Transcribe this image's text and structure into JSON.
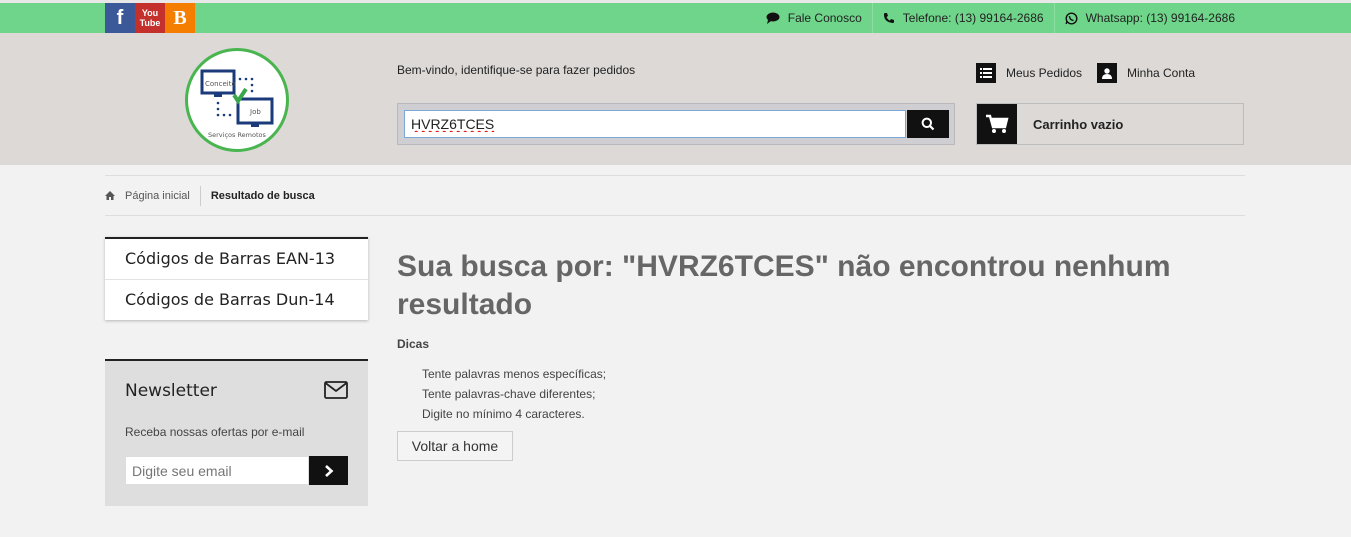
{
  "topbar": {
    "social": [
      {
        "name": "facebook",
        "glyph": "f",
        "color": "#3b5998"
      },
      {
        "name": "youtube",
        "glyph": "You Tube",
        "color": "#c4302b"
      },
      {
        "name": "blogger",
        "glyph": "B",
        "color": "#f57d00"
      }
    ],
    "contacts": {
      "fale": "Fale Conosco",
      "telefone": "Telefone: (13) 99164-2686",
      "whatsapp": "Whatsapp: (13) 99164-2686"
    },
    "bg_color": "#6fd58a"
  },
  "header": {
    "welcome": "Bem-vindo, identifique-se para fazer pedidos",
    "search_value": "HVRZ6TCES",
    "meus_pedidos": "Meus Pedidos",
    "minha_conta": "Minha Conta",
    "cart": "Carrinho vazio",
    "logo": {
      "text1": "Conceito",
      "text2": "Job",
      "text3": "Serviços Remotos"
    }
  },
  "breadcrumb": {
    "home": "Página inicial",
    "current": "Resultado de busca"
  },
  "sidebar": {
    "categories": [
      "Códigos de Barras EAN-13",
      "Códigos de Barras Dun-14"
    ],
    "newsletter": {
      "title": "Newsletter",
      "text": "Receba nossas ofertas por e-mail",
      "placeholder": "Digite seu email"
    }
  },
  "main": {
    "title": "Sua busca por: \"HVRZ6TCES\" não encontrou nenhum resultado",
    "tips_label": "Dicas",
    "tips": [
      "Tente palavras menos específicas;",
      "Tente palavras-chave diferentes;",
      "Digite no mínimo 4 caracteres."
    ],
    "home_button": "Voltar a home"
  }
}
